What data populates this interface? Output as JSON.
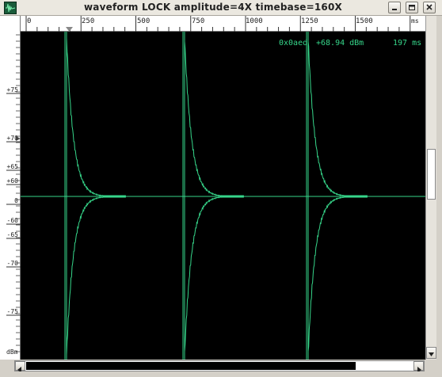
{
  "window": {
    "title": "waveform  LOCK amplitude=4X timebase=160X",
    "icons": {
      "app": "waveform-app-icon",
      "minimize": "minimize-icon",
      "maximize": "maximize-icon",
      "close": "close-icon"
    }
  },
  "ruler": {
    "ticks": [
      "0",
      "250",
      "500",
      "750",
      "1000",
      "1250",
      "1500"
    ],
    "unit": "ms"
  },
  "yaxis": {
    "labels": [
      "+75",
      "+70",
      "+65",
      "+60",
      "0",
      "-60",
      "-65",
      "-70",
      "-75"
    ],
    "unit": "dBm"
  },
  "readout": {
    "id": "0x0aed",
    "level": "+68.94 dBm",
    "time": "197 ms"
  },
  "colors": {
    "trace": "#36d68a",
    "background": "#000000"
  },
  "scrollbars": {
    "horizontal_position": 0.0,
    "vertical_position": 0.4
  }
}
